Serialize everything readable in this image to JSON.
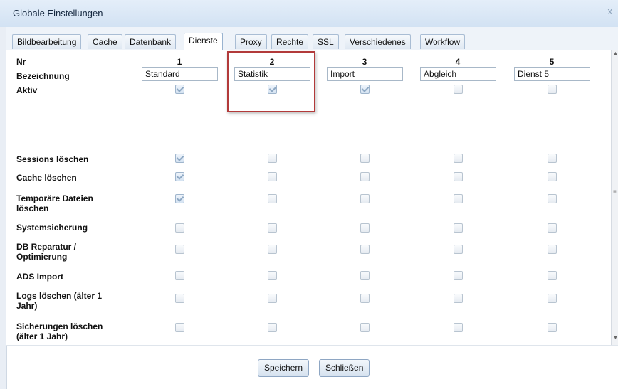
{
  "dialog": {
    "title": "Globale Einstellungen",
    "close_glyph": "x"
  },
  "tabs": [
    {
      "label": "Bildbearbeitung"
    },
    {
      "label": "Cache"
    },
    {
      "label": "Datenbank"
    },
    {
      "label": "Dienste",
      "active": true
    },
    {
      "label": "Proxy"
    },
    {
      "label": "Rechte"
    },
    {
      "label": "SSL"
    },
    {
      "label": "Verschiedenes"
    },
    {
      "label": "Workflow"
    }
  ],
  "labels": {
    "nr": "Nr",
    "bezeichnung": "Bezeichnung",
    "aktiv": "Aktiv"
  },
  "columns": [
    {
      "nr": "1",
      "name": "Standard"
    },
    {
      "nr": "2",
      "name": "Statistik"
    },
    {
      "nr": "3",
      "name": "Import"
    },
    {
      "nr": "4",
      "name": "Abgleich"
    },
    {
      "nr": "5",
      "name": "Dienst 5"
    }
  ],
  "aktiv": [
    true,
    true,
    true,
    false,
    false
  ],
  "tasks": [
    {
      "label": "Sessions löschen",
      "values": [
        true,
        false,
        false,
        false,
        false
      ]
    },
    {
      "label": "Cache löschen",
      "values": [
        true,
        false,
        false,
        false,
        false
      ]
    },
    {
      "label": "Temporäre Dateien löschen",
      "values": [
        true,
        false,
        false,
        false,
        false
      ]
    },
    {
      "label": "Systemsicherung",
      "values": [
        false,
        false,
        false,
        false,
        false
      ]
    },
    {
      "label": "DB Reparatur / Optimierung",
      "values": [
        false,
        false,
        false,
        false,
        false
      ]
    },
    {
      "label": "ADS Import",
      "values": [
        false,
        false,
        false,
        false,
        false
      ]
    },
    {
      "label": "Logs löschen (älter 1 Jahr)",
      "values": [
        false,
        false,
        false,
        false,
        false
      ]
    },
    {
      "label": "Sicherungen löschen (älter 1 Jahr)",
      "values": [
        false,
        false,
        false,
        false,
        false
      ]
    }
  ],
  "buttons": {
    "save": "Speichern",
    "close": "Schließen"
  }
}
